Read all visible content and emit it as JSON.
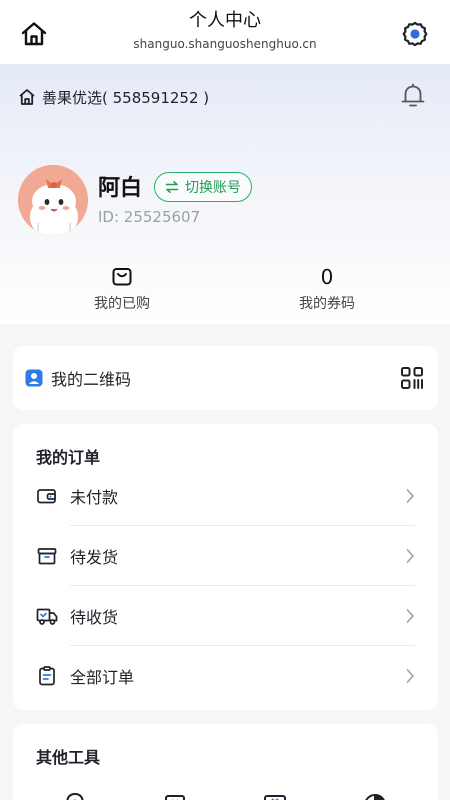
{
  "header": {
    "title": "个人中心",
    "domain": "shanguo.shanguoshenghuo.cn",
    "icons": {
      "home": "home-icon",
      "settings": "gear-icon"
    },
    "settings_color": "#2f6fd6"
  },
  "shop": {
    "name": "善果优选( 558591252 )",
    "icon": "home-outline-icon",
    "bell_icon": "bell-icon"
  },
  "profile": {
    "name": "阿白",
    "switch_label": "切换账号",
    "id_text": "ID: 25525607",
    "accent": "#1f9d55"
  },
  "stats": [
    {
      "value": "",
      "icon": "shopping-bag-icon",
      "label": "我的已购"
    },
    {
      "value": "0",
      "label": "我的券码"
    }
  ],
  "qr": {
    "label": "我的二维码",
    "icon": "qr-code-icon",
    "badge_color": "#2f7be6"
  },
  "orders": {
    "title": "我的订单",
    "items": [
      {
        "label": "未付款",
        "icon": "wallet-icon"
      },
      {
        "label": "待发货",
        "icon": "package-icon"
      },
      {
        "label": "待收货",
        "icon": "truck-icon"
      },
      {
        "label": "全部订单",
        "icon": "clipboard-icon"
      }
    ]
  },
  "tools": {
    "title": "其他工具"
  }
}
